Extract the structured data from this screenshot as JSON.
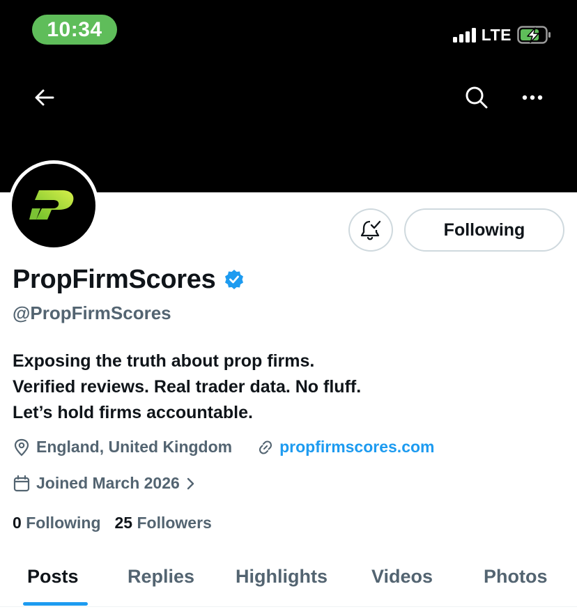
{
  "status_bar": {
    "time": "10:34",
    "network": "LTE",
    "icons": [
      "signal-bars-icon",
      "battery-charging-icon"
    ]
  },
  "nav": {
    "icons": [
      "back-arrow-icon",
      "search-icon",
      "more-icon"
    ]
  },
  "profile": {
    "display_name": "PropFirmScores",
    "verified": true,
    "handle": "@PropFirmScores",
    "bio_lines": [
      "Exposing the truth about prop firms.",
      "Verified reviews. Real trader data. No fluff.",
      "Let’s hold firms accountable."
    ],
    "location": "England, United Kingdom",
    "website": "propfirmscores.com",
    "joined": "Joined March 2026",
    "following_count": "0",
    "following_label": "Following",
    "followers_count": "25",
    "followers_label": "Followers"
  },
  "actions": {
    "follow_label": "Following",
    "notification_icon": "bell-check-icon"
  },
  "tabs": [
    {
      "label": "Posts",
      "active": true
    },
    {
      "label": "Replies",
      "active": false
    },
    {
      "label": "Highlights",
      "active": false
    },
    {
      "label": "Videos",
      "active": false
    },
    {
      "label": "Photos",
      "active": false
    }
  ],
  "colors": {
    "accent": "#1d9bf0",
    "status_time_bg": "#5fbd5a",
    "logo_green": "#b6e03c",
    "secondary_text": "#536471"
  }
}
